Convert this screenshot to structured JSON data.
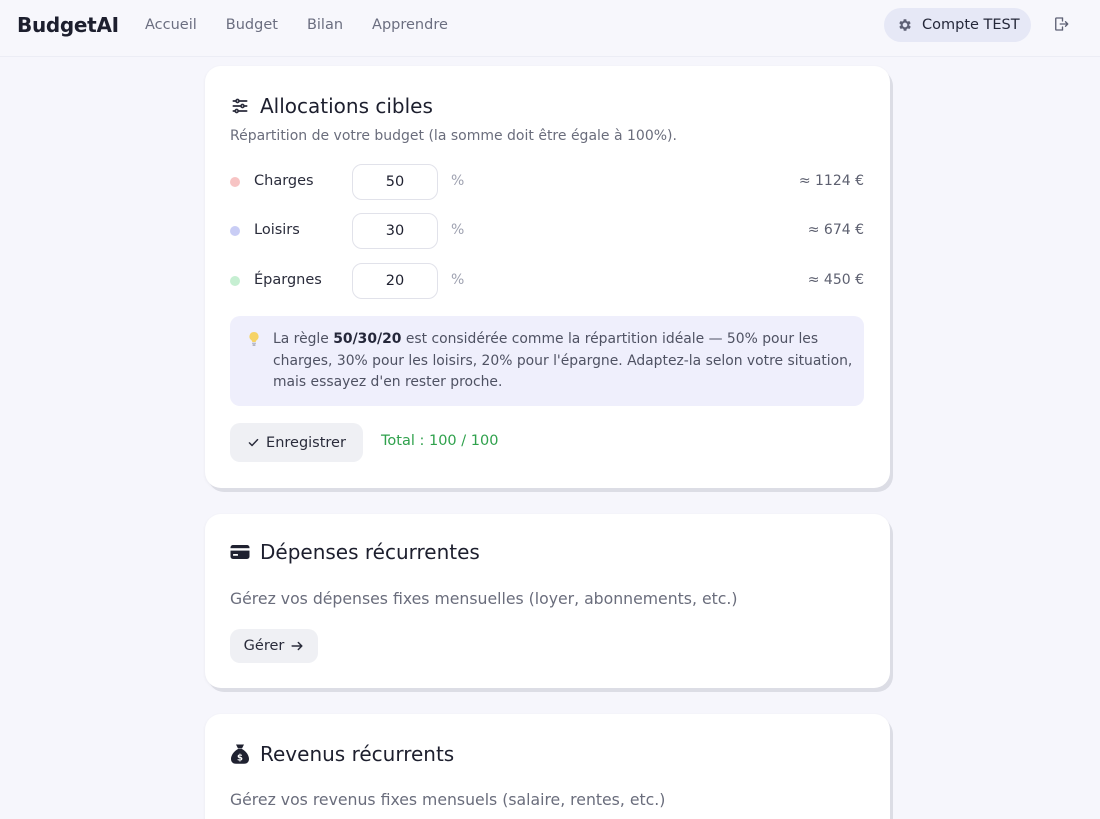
{
  "nav": {
    "brand": "BudgetAI",
    "links": [
      "Accueil",
      "Budget",
      "Bilan",
      "Apprendre"
    ],
    "account_label": "Compte TEST"
  },
  "allocations": {
    "title": "Allocations cibles",
    "subtitle": "Répartition de votre budget (la somme doit être égale à 100%).",
    "rows": [
      {
        "label": "Charges",
        "value": "50",
        "unit": "%",
        "amount": "≈ 1124 €",
        "color": "#f7c4c4"
      },
      {
        "label": "Loisirs",
        "value": "30",
        "unit": "%",
        "amount": "≈ 674 €",
        "color": "#c9cdf5"
      },
      {
        "label": "Épargnes",
        "value": "20",
        "unit": "%",
        "amount": "≈ 450 €",
        "color": "#c6efd2"
      }
    ],
    "tip": {
      "prefix": "La règle ",
      "rule": "50/30/20",
      "suffix": " est considérée comme la répartition idéale — 50% pour les charges, 30% pour les loisirs, 20% pour l'épargne. Adaptez-la selon votre situation, mais essayez d'en rester proche."
    },
    "save_label": "Enregistrer",
    "total_label": "Total : 100 / 100"
  },
  "recurring_expenses": {
    "title": "Dépenses récurrentes",
    "description": "Gérez vos dépenses fixes mensuelles (loyer, abonnements, etc.)",
    "button_label": "Gérer"
  },
  "recurring_income": {
    "title": "Revenus récurrents",
    "description": "Gérez vos revenus fixes mensuels (salaire, rentes, etc.)"
  }
}
